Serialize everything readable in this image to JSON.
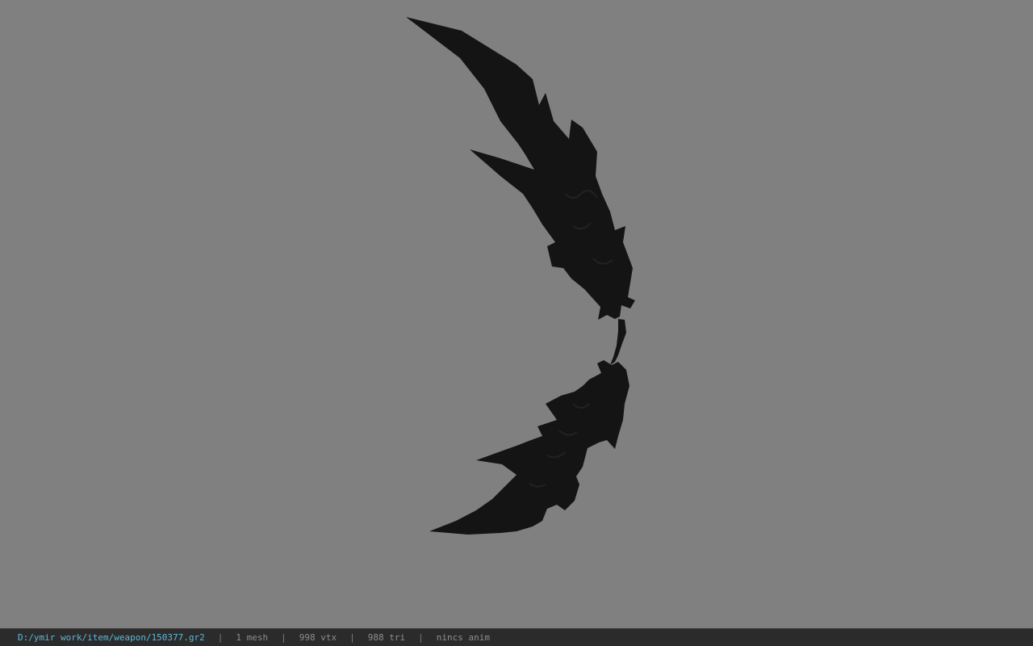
{
  "viewport": {
    "background_color": "#808080",
    "model_color": "#111111",
    "model_name": "scythe-blade-model"
  },
  "status_bar": {
    "file_path": "D:/ymir work/item/weapon/150377.gr2",
    "mesh_count": "1 mesh",
    "vertex_count": "998 vtx",
    "triangle_count": "988 tri",
    "anim_status": "nincs anim",
    "separator": "|",
    "path_color": "#5fb8d8"
  }
}
